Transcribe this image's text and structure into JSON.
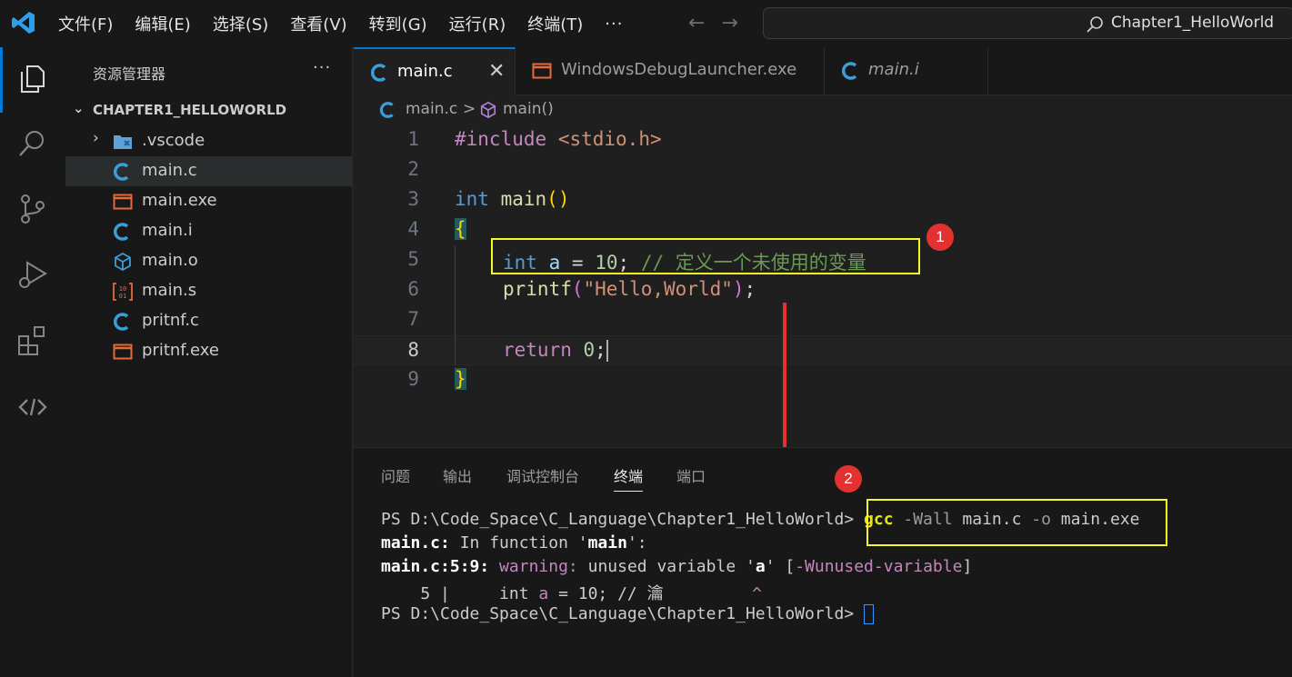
{
  "menu": {
    "items": [
      "文件(F)",
      "编辑(E)",
      "选择(S)",
      "查看(V)",
      "转到(G)",
      "运行(R)",
      "终端(T)"
    ],
    "more": "···"
  },
  "search": {
    "text": "Chapter1_HelloWorld"
  },
  "sidebar": {
    "title": "资源管理器",
    "more": "···",
    "folder": "CHAPTER1_HELLOWORLD",
    "items": [
      {
        "label": ".vscode",
        "icon": "vscode-folder-icon"
      },
      {
        "label": "main.c",
        "icon": "c-file-icon"
      },
      {
        "label": "main.exe",
        "icon": "exe-file-icon"
      },
      {
        "label": "main.i",
        "icon": "c-file-icon"
      },
      {
        "label": "main.o",
        "icon": "object-file-icon"
      },
      {
        "label": "main.s",
        "icon": "asm-file-icon"
      },
      {
        "label": "pritnf.c",
        "icon": "c-file-icon"
      },
      {
        "label": "pritnf.exe",
        "icon": "exe-file-icon"
      }
    ]
  },
  "tabs": [
    {
      "label": "main.c",
      "close": "✕"
    },
    {
      "label": "WindowsDebugLauncher.exe"
    },
    {
      "label": "main.i"
    }
  ],
  "breadcrumb": {
    "file": "main.c",
    "separator": ">",
    "symbol": "main()"
  },
  "editor": {
    "line_numbers": [
      "1",
      "2",
      "3",
      "4",
      "5",
      "6",
      "7",
      "8",
      "9"
    ],
    "tokens": {
      "include": "#include",
      "header": "<stdio.h>",
      "int": "int",
      "main": "main",
      "parens": "()",
      "open_brace": "{",
      "close_brace": "}",
      "var_a": "a",
      "eq": "=",
      "ten": "10",
      "semi": ";",
      "comment": "// 定义一个未使用的变量",
      "printf": "printf",
      "lparen": "(",
      "rparen": ")",
      "hello": "\"Hello,World\"",
      "return": "return",
      "zero": "0"
    }
  },
  "annotations": {
    "badge1": "1",
    "badge2": "2"
  },
  "panel": {
    "tabs": [
      "问题",
      "输出",
      "调试控制台",
      "终端",
      "端口"
    ],
    "active_tab": "终端"
  },
  "terminal": {
    "prompt": "PS D:\\Code_Space\\C_Language\\Chapter1_HelloWorld> ",
    "cmd_gcc": "gcc",
    "cmd_wall": " -Wall ",
    "cmd_file": "main.c",
    "cmd_o": " -o ",
    "cmd_out": "main.exe",
    "line2_a": "main.c:",
    "line2_b": " In function '",
    "line2_c": "main",
    "line2_d": "':",
    "line3_a": "main.c:5:9:",
    "line3_b": " warning:",
    "line3_c": " unused variable '",
    "line3_d": "a",
    "line3_e": "' [",
    "line3_f": "-Wunused-variable",
    "line3_g": "]",
    "line4_a": "    5 |     int ",
    "line4_b": "a",
    "line4_c": " = 10; // 瀹         ",
    "line4_d": "^",
    "prompt2": "PS D:\\Code_Space\\C_Language\\Chapter1_HelloWorld> "
  },
  "colors": {
    "accent": "#0078d4",
    "annotation_box": "#f7f72a",
    "annotation_red": "#e33131"
  }
}
